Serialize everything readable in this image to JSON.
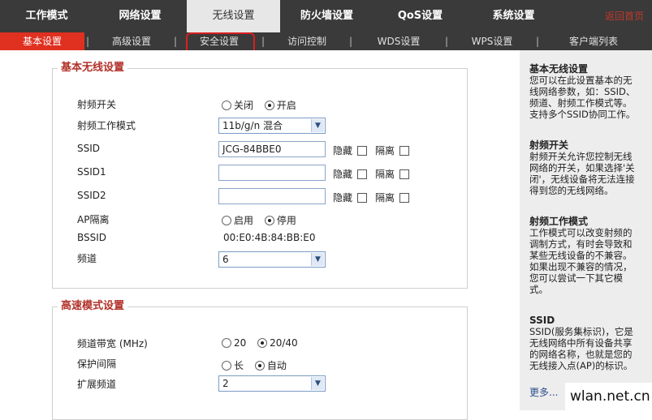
{
  "top_tabs": [
    "工作模式",
    "网络设置",
    "无线设置",
    "防火墙设置",
    "QoS设置",
    "系统设置"
  ],
  "home_link": "返回首页",
  "sub_tabs": [
    "基本设置",
    "高级设置",
    "安全设置",
    "访问控制",
    "WDS设置",
    "WPS设置",
    "客户端列表"
  ],
  "basic": {
    "legend": "基本无线设置",
    "radio_label": "射频开关",
    "radio_off": "关闭",
    "radio_on": "开启",
    "mode_label": "射频工作模式",
    "mode_value": "11b/g/n 混合",
    "ssid_label": "SSID",
    "ssid_value": "JCG-84BBE0",
    "ssid1_label": "SSID1",
    "ssid1_value": "",
    "ssid2_label": "SSID2",
    "ssid2_value": "",
    "hide": "隐藏",
    "isolate": "隔离",
    "ap_label": "AP隔离",
    "ap_enable": "启用",
    "ap_disable": "停用",
    "bssid_label": "BSSID",
    "bssid_value": "00:E0:4B:84:BB:E0",
    "channel_label": "频道",
    "channel_value": "6"
  },
  "ht": {
    "legend": "高速模式设置",
    "bw_label": "频道带宽 (MHz)",
    "bw_20": "20",
    "bw_2040": "20/40",
    "gi_label": "保护间隔",
    "gi_long": "长",
    "gi_auto": "自动",
    "ext_label": "扩展频道",
    "ext_value": "2"
  },
  "help": {
    "b1_title": "基本无线设置",
    "b1_text": "您可以在此设置基本的无线网络参数，如：SSID、频道、射频工作模式等。支持多个SSID协同工作。",
    "b2_title": "射频开关",
    "b2_text": "射频开关允许您控制无线网络的开关，如果选择'关闭'，无线设备将无法连接得到您的无线网络。",
    "b3_title": "射频工作模式",
    "b3_text": "工作模式可以改变射频的调制方式，有时会导致和某些无线设备的不兼容。如果出现不兼容的情况，您可以尝试一下其它模式。",
    "b4_title": "SSID",
    "b4_text": "SSID(服务集标识)，它是无线网络中所有设备共享的网络名称，也就是您的无线接入点(AP)的标识。",
    "more": "更多..."
  },
  "watermark": "wlan.net.cn"
}
